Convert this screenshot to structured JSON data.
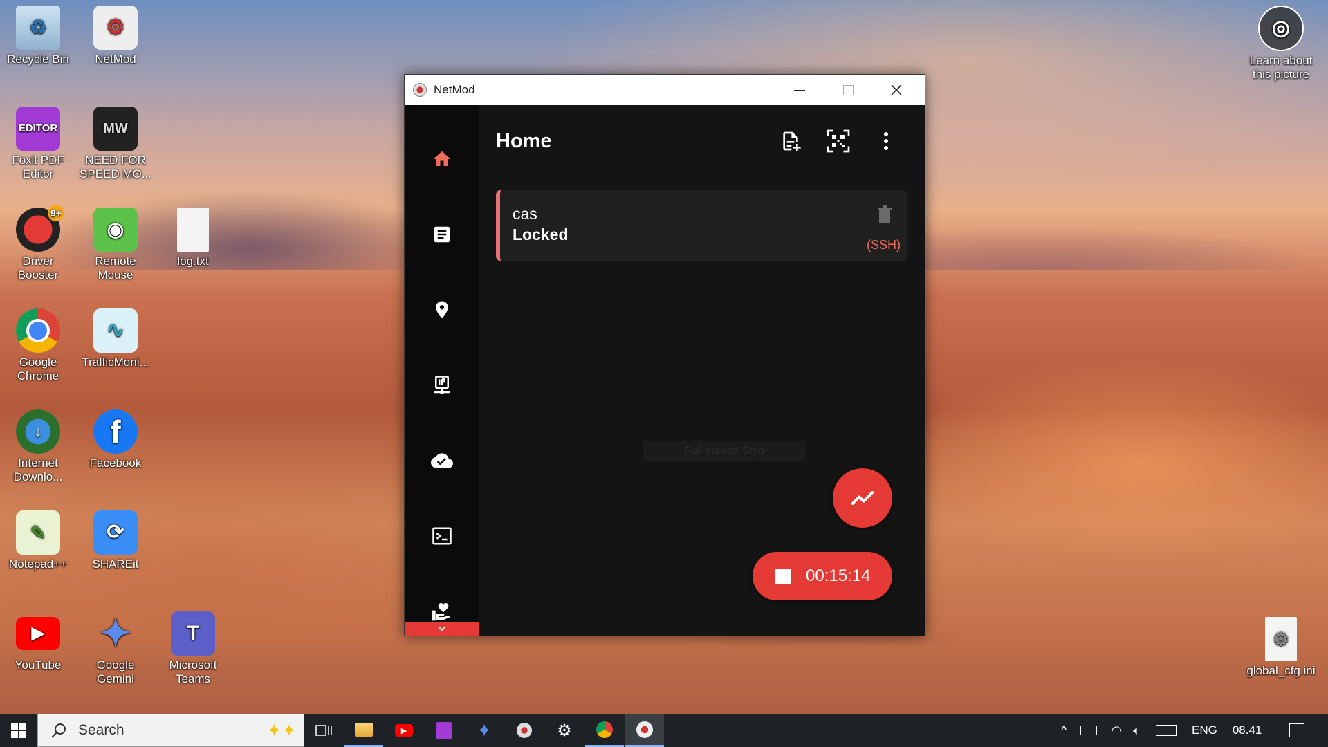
{
  "desktop": {
    "icons": [
      {
        "label": "Recycle Bin",
        "icon": "recycle-bin-icon"
      },
      {
        "label": "NetMod",
        "icon": "netmod-icon"
      },
      {
        "label": "Foxit PDF\nEditor",
        "icon": "foxit-pdf-editor-icon",
        "glyph": "EDITOR"
      },
      {
        "label": "NEED FOR\nSPEED MO...",
        "icon": "nfs-most-wanted-icon",
        "glyph": "MW"
      },
      {
        "label": "Driver\nBooster",
        "icon": "driver-booster-icon",
        "badge": "9+"
      },
      {
        "label": "Remote\nMouse",
        "icon": "remote-mouse-icon"
      },
      {
        "label": "log.txt",
        "icon": "text-file-icon"
      },
      {
        "label": "Google\nChrome",
        "icon": "chrome-icon"
      },
      {
        "label": "TrafficMoni...",
        "icon": "traffic-monitor-icon"
      },
      {
        "label": "Internet\nDownlo...",
        "icon": "internet-download-manager-icon"
      },
      {
        "label": "Facebook",
        "icon": "facebook-icon",
        "glyph": "f"
      },
      {
        "label": "Notepad++",
        "icon": "notepad-plus-plus-icon"
      },
      {
        "label": "SHAREit",
        "icon": "shareit-icon"
      },
      {
        "label": "YouTube",
        "icon": "youtube-icon"
      },
      {
        "label": "Google\nGemini",
        "icon": "gemini-icon"
      },
      {
        "label": "Microsoft\nTeams",
        "icon": "teams-icon",
        "glyph": "T"
      },
      {
        "label": "Learn about\nthis picture",
        "icon": "learn-about-picture-icon"
      },
      {
        "label": "global_cfg.ini",
        "icon": "ini-file-icon"
      }
    ]
  },
  "window": {
    "title": "NetMod",
    "controls": {
      "minimize": "minimize-icon",
      "maximize": "maximize-icon",
      "close": "close-icon"
    }
  },
  "sidebar": {
    "items": [
      {
        "name": "home",
        "icon": "home-icon",
        "active": true
      },
      {
        "name": "logs",
        "icon": "log-icon"
      },
      {
        "name": "location",
        "icon": "location-pin-icon"
      },
      {
        "name": "ip",
        "icon": "ip-network-icon"
      },
      {
        "name": "cloud",
        "icon": "cloud-done-icon"
      },
      {
        "name": "terminal",
        "icon": "terminal-icon"
      },
      {
        "name": "support",
        "icon": "volunteer-heart-icon"
      }
    ],
    "expand_icon": "chevron-down-icon"
  },
  "main": {
    "title": "Home",
    "actions": [
      "add-config-icon",
      "qr-scan-icon",
      "more-vert-icon"
    ],
    "configs": [
      {
        "name": "cas",
        "status": "Locked",
        "protocol": "(SSH)"
      }
    ],
    "ghost_text": "Full-screen Snip",
    "fab_icon": "trending-up-icon",
    "timer": {
      "time": "00:15:14",
      "icon": "stop-icon"
    }
  },
  "taskbar": {
    "search_placeholder": "Search",
    "apps": [
      "task-view-icon",
      "file-explorer-icon",
      "youtube-icon",
      "foxit-editor-icon",
      "gemini-icon",
      "netmod-tray-icon",
      "settings-icon",
      "chrome-icon",
      "netmod-icon"
    ],
    "tray": {
      "language": "ENG",
      "time": "08.41"
    }
  },
  "colors": {
    "accent": "#e53935",
    "card_border": "#e57373",
    "protocol": "#ef6c5a"
  }
}
